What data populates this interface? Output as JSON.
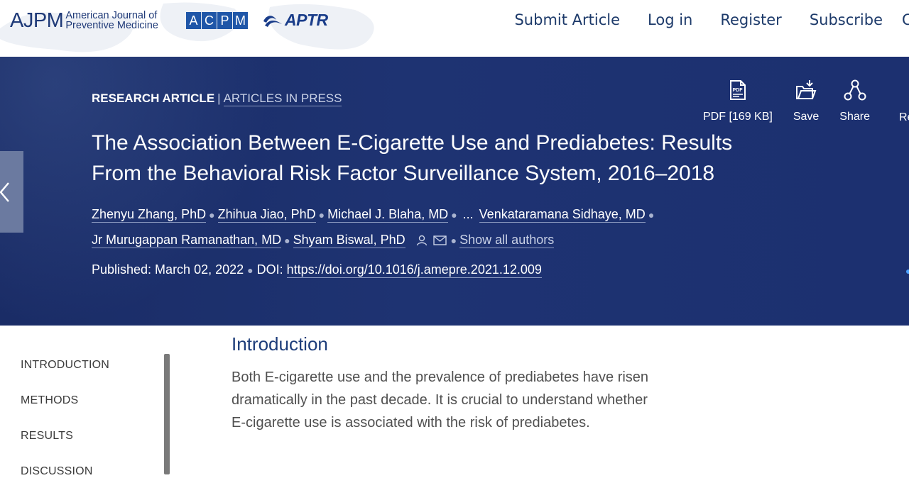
{
  "header": {
    "logo_ajpm": "AJPM",
    "logo_ajpm_sub_line1": "American Journal of",
    "logo_ajpm_sub_line2": "Preventive Medicine",
    "logo_acpm_letters": [
      "A",
      "C",
      "P",
      "M"
    ],
    "logo_aptr": "APTR",
    "nav": [
      "Submit Article",
      "Log in",
      "Register",
      "Subscribe"
    ],
    "nav_cut": "C"
  },
  "article": {
    "type": "RESEARCH ARTICLE",
    "separator": "|",
    "status": "ARTICLES IN PRESS",
    "title": "The Association Between E-Cigarette Use and Prediabetes: Results From the Behavioral Risk Factor Surveillance System, 2016–2018",
    "authors": [
      "Zhenyu Zhang, PhD",
      "Zhihua Jiao, PhD",
      "Michael J. Blaha, MD",
      "Venkataramana Sidhaye, MD",
      "Jr Murugappan Ramanathan, MD",
      "Shyam Biswal, PhD"
    ],
    "ellipsis": "...",
    "show_all": "Show all authors",
    "published": "Published: March 02, 2022",
    "doi_label": "DOI:",
    "doi": "https://doi.org/10.1016/j.amepre.2021.12.009"
  },
  "tools": {
    "pdf": "PDF [169 KB]",
    "save": "Save",
    "share": "Share",
    "cut": "Re"
  },
  "toc": {
    "items": [
      "INTRODUCTION",
      "METHODS",
      "RESULTS",
      "DISCUSSION"
    ]
  },
  "content": {
    "section_title": "Introduction",
    "body": "Both E-cigarette use and the prevalence of prediabetes have risen dramatically in the past decade. It is crucial to understand whether E-cigarette use is associated with the risk of prediabetes."
  },
  "colors": {
    "banner": "#1e3372",
    "brand": "#1f3a78",
    "section_title": "#1d3d7a"
  }
}
